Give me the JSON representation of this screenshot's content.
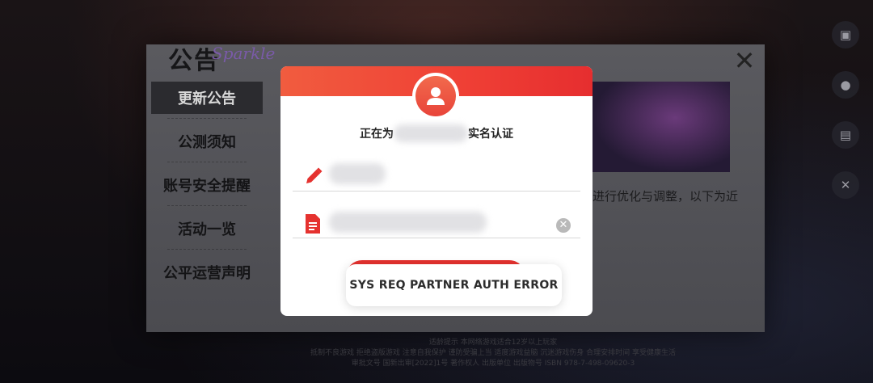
{
  "notice": {
    "title": "公告",
    "title_decoration": "Sparkle",
    "tabs": [
      "更新公告",
      "公测须知",
      "账号安全提醒",
      "活动一览",
      "公平运营声明"
    ],
    "body_snippet": "进行优化与调整，以下为近",
    "footer_line1": "适龄提示 本网络游戏适合12岁以上玩家",
    "footer_line2": "抵制不良游戏 拒绝盗版游戏 注意自我保护 谨防受骗上当 适度游戏益脑 沉迷游戏伤身 合理安排时间 享受健康生活",
    "footer_line3": "审批文号 国新出审[2022]1号 著作权人 出版单位 出版物号 ISBN 978-7-498-09620-3"
  },
  "side_icons": [
    "gift-icon",
    "user-icon",
    "message-icon",
    "tools-icon"
  ],
  "dialog": {
    "title_prefix": "正在为",
    "title_suffix": "实名认证",
    "colors": {
      "accent": "#e5322f",
      "header_start": "#f15c3f"
    }
  },
  "toast": {
    "message": "SYS REQ PARTNER AUTH ERROR"
  }
}
